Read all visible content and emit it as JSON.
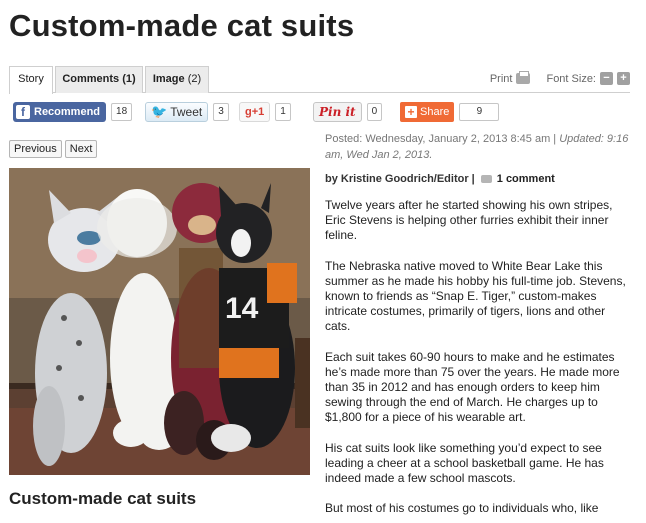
{
  "headline": "Custom-made cat suits",
  "tabs": {
    "story": "Story",
    "comments": "Comments (1)",
    "image": "Image",
    "image_count": "(2)"
  },
  "tools": {
    "print": "Print",
    "font_size": "Font Size:"
  },
  "social": {
    "facebook_label": "Recommend",
    "facebook_count": "18",
    "twitter_label": "Tweet",
    "twitter_count": "3",
    "gplus_label": "g+1",
    "gplus_count": "1",
    "pinterest_label": "Pin it",
    "pinterest_count": "0",
    "share_label": "Share",
    "share_count": "9"
  },
  "pager": {
    "previous": "Previous",
    "next": "Next"
  },
  "photo": {
    "jersey_number": "14"
  },
  "caption": "Custom-made cat suits",
  "meta": {
    "posted": "Posted: Wednesday, January 2, 2013 8:45 am |",
    "updated": "Updated: 9:16 am, Wed Jan 2, 2013."
  },
  "byline": {
    "author": "by Kristine Goodrich/Editor |",
    "comments_link": "1 comment"
  },
  "article": {
    "paragraphs": [
      "Twelve years after he started showing his own stripes, Eric Stevens is helping other furries exhibit their inner feline.",
      "The Nebraska native moved to White Bear Lake this summer as he made his hobby his full-time job. Stevens, known to friends as “Snap E. Tiger,” custom-makes intricate costumes, primarily of tigers, lions and other cats.",
      "Each suit takes 60-90 hours to make and he estimates he’s made more than 75 over the years. He made more than 35 in 2012 and has enough orders to keep him sewing through the end of March. He charges up to $1,800 for a piece of his wearable art.",
      "His cat suits look like something you’d expect to see leading a cheer at a school basketball game. He has indeed made a few school mascots.",
      "But most of his costumes go to individuals who, like"
    ]
  }
}
